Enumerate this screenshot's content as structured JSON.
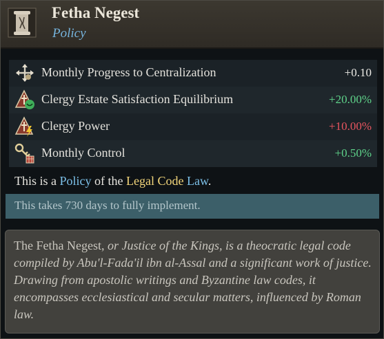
{
  "header": {
    "title": "Fetha Negest",
    "subtitle": "Policy",
    "icon": "scroll-pillar-icon"
  },
  "modifiers": [
    {
      "icon": "centralization-arrows-icon",
      "label": "Monthly Progress to Centralization",
      "value": "+0.10",
      "tone": "neutral"
    },
    {
      "icon": "clergy-satisfaction-icon",
      "label": "Clergy Estate Satisfaction Equilibrium",
      "value": "+20.00%",
      "tone": "positive"
    },
    {
      "icon": "clergy-power-icon",
      "label": "Clergy Power",
      "value": "+10.00%",
      "tone": "negative"
    },
    {
      "icon": "control-key-icon",
      "label": "Monthly Control",
      "value": "+0.50%",
      "tone": "positive"
    }
  ],
  "law_line": {
    "prefix": "This is a ",
    "policy": "Policy",
    "middle": " of the ",
    "legal_code": "Legal Code",
    "space": " ",
    "law": "Law",
    "suffix": "."
  },
  "duration": "This takes 730 days to fully implement.",
  "description": {
    "p1": "The Fetha Negest, ",
    "p2": "or Justice of the Kings, is a theocratic legal code compiled by Abu'l-Fada'il ibn al-Assal and a significant work of justice. Drawing from apostolic writings and Byzantine law codes, it encompasses ecclesiastical and secular matters, influenced by Roman law."
  },
  "colors": {
    "positive": "#5fd38a",
    "negative": "#e8555f",
    "link_blue": "#7cc0e8",
    "link_gold": "#f3d67b"
  }
}
